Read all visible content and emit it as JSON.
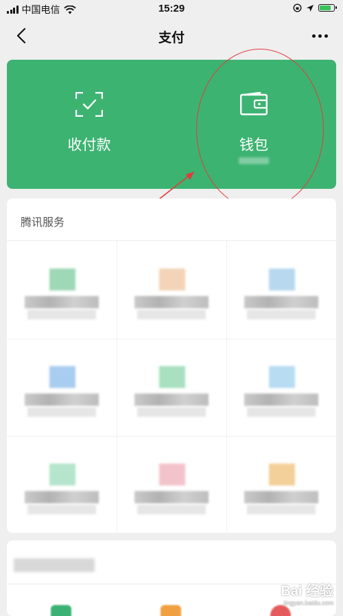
{
  "status": {
    "carrier": "中国电信",
    "time": "15:29",
    "battery_level": 0.85
  },
  "nav": {
    "title": "支付",
    "back_icon": "chevron-left-icon",
    "more_icon": "more-dots-icon"
  },
  "card": {
    "color": "#3db372",
    "receive_label": "收付款",
    "wallet_label": "钱包",
    "receive_icon": "scan-check-icon",
    "wallet_icon": "wallet-icon"
  },
  "services": {
    "title": "腾讯服务",
    "icon_colors": [
      "#9ed8b6",
      "#f3d4b8",
      "#b8d8ef",
      "#a9cdf0",
      "#a8e0c0",
      "#b8dcf2",
      "#b5e5cd",
      "#f3c3cb",
      "#f3d09a"
    ]
  },
  "annotation": {
    "circle_color": "#e23b3b"
  },
  "watermark": {
    "brand": "Bai 经验",
    "url": "jingyan.baidu.com"
  }
}
